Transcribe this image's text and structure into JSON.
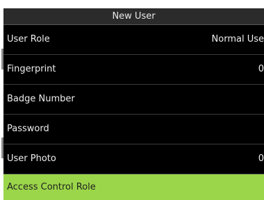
{
  "window": {
    "title": "New User"
  },
  "menu": {
    "items": [
      {
        "label": "User Role",
        "value": "Normal Use",
        "selected": false
      },
      {
        "label": "Fingerprint",
        "value": "0",
        "selected": false
      },
      {
        "label": "Badge Number",
        "value": "",
        "selected": false
      },
      {
        "label": "Password",
        "value": "",
        "selected": false
      },
      {
        "label": "User Photo",
        "value": "0",
        "selected": false
      },
      {
        "label": "Access Control Role",
        "value": "",
        "selected": true
      }
    ]
  },
  "colors": {
    "background": "#000000",
    "title_bar": "#2b2b2b",
    "selected_row": "#9bd64a",
    "text": "#eeeeee"
  }
}
